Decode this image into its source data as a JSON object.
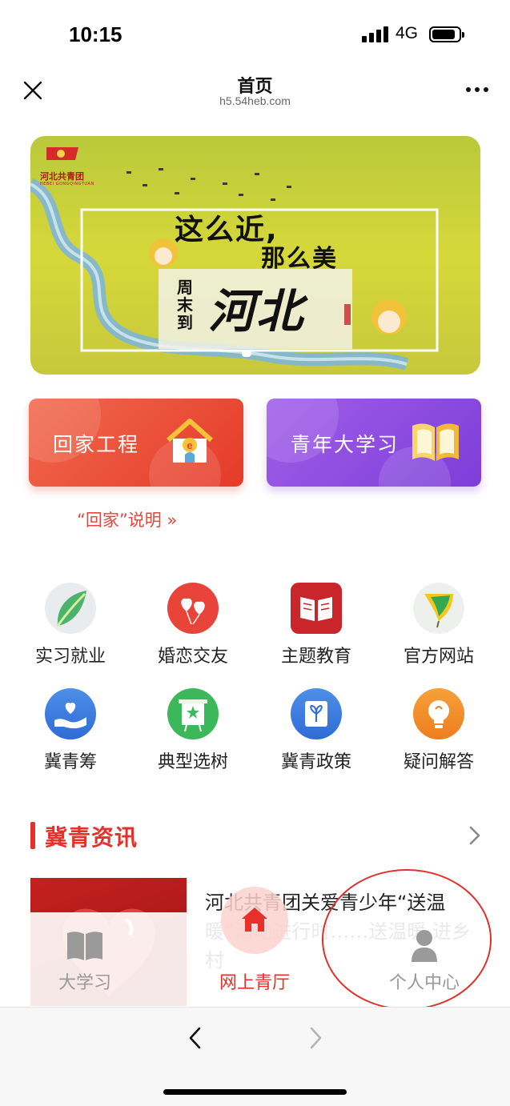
{
  "status_bar": {
    "time": "10:15",
    "network": "4G"
  },
  "header": {
    "title": "首页",
    "url": "h5.54heb.com"
  },
  "banner": {
    "logo_text": "河北共青团",
    "logo_sub": "HEBEI GONGQINGTUAN",
    "line1": "这么近,",
    "line2": "那么美",
    "vertical": "周末到",
    "big": "河北"
  },
  "cards": [
    {
      "label": "回家工程",
      "icon": "house-e-icon"
    },
    {
      "label": "青年大学习",
      "icon": "open-book-icon"
    }
  ],
  "home_explain": "“回家”说明 »",
  "grid": [
    {
      "label": "实习就业",
      "icon": "leaf-icon"
    },
    {
      "label": "婚恋交友",
      "icon": "heart-balloons-icon"
    },
    {
      "label": "主题教育",
      "icon": "book-icon"
    },
    {
      "label": "官方网站",
      "icon": "ginkgo-icon"
    },
    {
      "label": "冀青筹",
      "icon": "hand-heart-icon"
    },
    {
      "label": "典型选树",
      "icon": "star-board-icon"
    },
    {
      "label": "冀青政策",
      "icon": "document-sprout-icon"
    },
    {
      "label": "疑问解答",
      "icon": "lightbulb-icon"
    }
  ],
  "section": {
    "title": "冀青资讯"
  },
  "news": [
    {
      "title": "河北共青团关爱青少年“送温暖”活动进行时……送温暖 进乡村"
    }
  ],
  "tabbar": [
    {
      "label": "大学习",
      "icon": "book-icon",
      "active": false
    },
    {
      "label": "网上青厅",
      "icon": "house-icon",
      "active": true
    },
    {
      "label": "个人中心",
      "icon": "person-icon",
      "active": false
    }
  ],
  "colors": {
    "accent": "#e8302a",
    "card_home": "#e8432e",
    "card_study": "#8a48e0"
  }
}
